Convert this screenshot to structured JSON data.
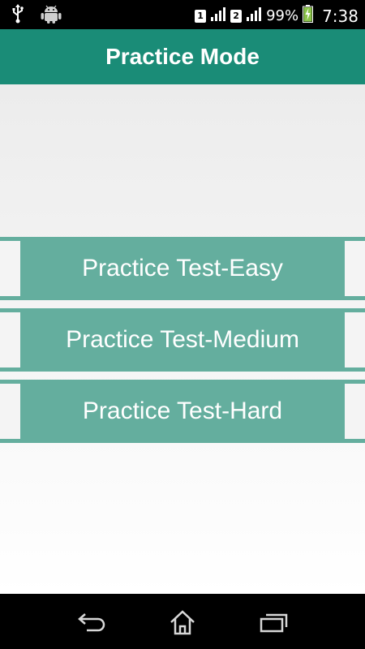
{
  "status_bar": {
    "icons_left": [
      "usb-icon",
      "android-icon"
    ],
    "sim1": "1",
    "sim2": "2",
    "battery": "99%",
    "time": "7:38"
  },
  "app_bar": {
    "title": "Practice Mode"
  },
  "options": [
    {
      "label": "Practice Test-Easy"
    },
    {
      "label": "Practice Test-Medium"
    },
    {
      "label": "Practice Test-Hard"
    }
  ],
  "nav_bar": {
    "buttons": [
      "back-icon",
      "home-icon",
      "recent-apps-icon"
    ]
  },
  "colors": {
    "app_bar": "#1a8c77",
    "button": "#64ae9e"
  }
}
